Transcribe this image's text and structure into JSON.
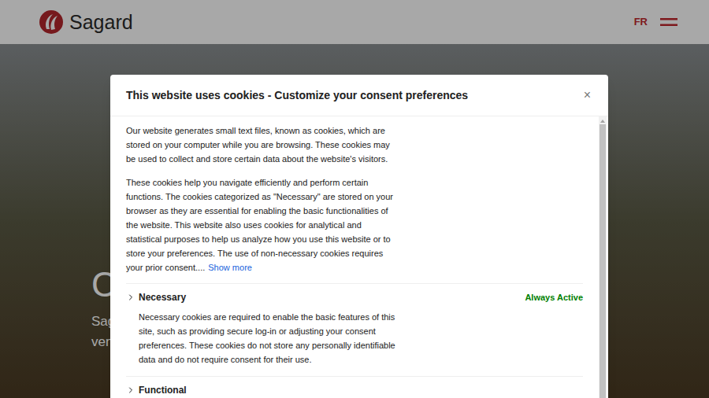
{
  "header": {
    "logo": "Sagard",
    "language": "FR"
  },
  "hero": {
    "title": "C",
    "subtitle_lines": [
      "Sag",
      "ven"
    ]
  },
  "dialog": {
    "title": "This website uses cookies - Customize your consent preferences",
    "close": "×",
    "intro": [
      [
        "Our website generates small text files, known as cookies, which are",
        "stored on your computer while you are browsing. These cookies may",
        "be used to collect and store certain data about the website's visitors."
      ],
      [
        "These cookies help you navigate efficiently and perform certain",
        "functions. The cookies categorized as \"Necessary\" are stored on your",
        "browser as they are essential for enabling the basic functionalities of",
        "the website. This website also uses cookies for analytical and",
        "statistical purposes to help us analyze how you use this website or to",
        "store your preferences. The use of non-necessary cookies requires",
        "your prior consent...."
      ]
    ],
    "show_more": "Show more",
    "categories": [
      {
        "name": "Necessary",
        "status": "Always Active",
        "description": [
          "Necessary cookies are required to enable the basic features of this",
          "site, such as providing secure log-in or adjusting your consent",
          "preferences. These cookies do not store any personally identifiable",
          "data and do not require consent for their use."
        ]
      },
      {
        "name": "Functional",
        "status": "",
        "description": []
      }
    ]
  }
}
